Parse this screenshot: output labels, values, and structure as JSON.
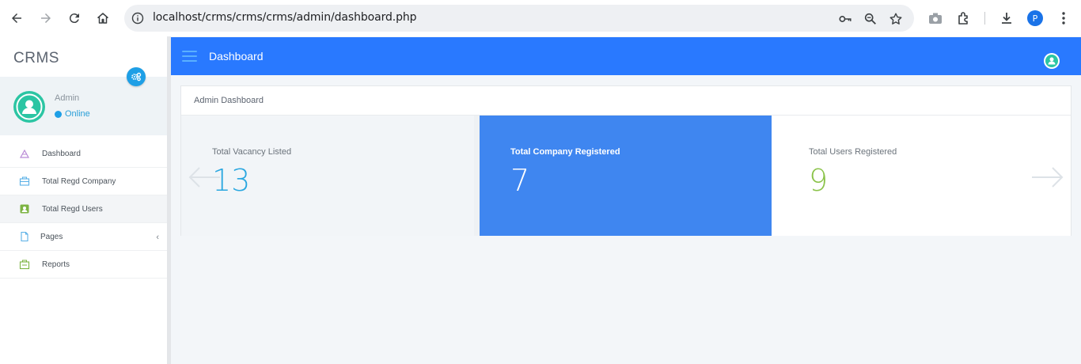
{
  "browser": {
    "url": "localhost/crms/crms/crms/admin/dashboard.php",
    "profile_initial": "P"
  },
  "sidebar": {
    "brand": "CRMS",
    "user": {
      "name": "Admin",
      "status": "Online"
    },
    "items": [
      {
        "label": "Dashboard",
        "icon": "dashboard-icon",
        "color": "#b98bd6"
      },
      {
        "label": "Total Regd Company",
        "icon": "company-icon",
        "color": "#5ab0e6"
      },
      {
        "label": "Total Regd Users",
        "icon": "user-card-icon",
        "color": "#7cb342"
      },
      {
        "label": "Pages",
        "icon": "pages-icon",
        "color": "#5ab0e6",
        "chevron": "‹"
      },
      {
        "label": "Reports",
        "icon": "reports-icon",
        "color": "#7cb342"
      }
    ]
  },
  "header": {
    "title": "Dashboard"
  },
  "main": {
    "card_title": "Admin Dashboard",
    "stats": [
      {
        "label": "Total Vacancy Listed",
        "value": "13",
        "value_color": "#2aa7e0",
        "bg": "#f2f5f8"
      },
      {
        "label": "Total Company Registered",
        "value": "7",
        "value_color": "#ffffff",
        "bg": "#3f86f0"
      },
      {
        "label": "Total Users Registered",
        "value": "9",
        "value_color": "#8bc34a",
        "bg": "#ffffff"
      }
    ]
  },
  "colors": {
    "accent": "#2979ff",
    "online": "#1e9fe6",
    "avatar": "#2bc5a3"
  }
}
